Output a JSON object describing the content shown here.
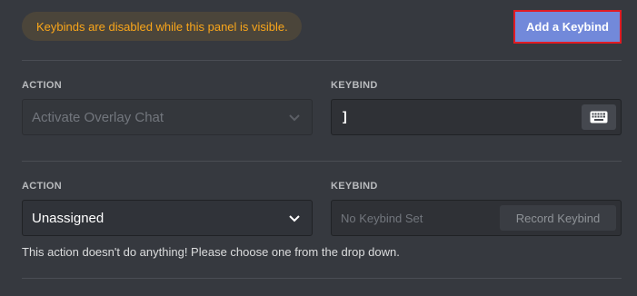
{
  "notice": "Keybinds are disabled while this panel is visible.",
  "add_button": "Add a Keybind",
  "keybinds": [
    {
      "action_label": "ACTION",
      "action_value": "Activate Overlay Chat",
      "keybind_label": "KEYBIND",
      "keybind_value": "]",
      "keyboard_icon": "keyboard-icon"
    },
    {
      "action_label": "ACTION",
      "action_value": "Unassigned",
      "keybind_label": "KEYBIND",
      "keybind_placeholder": "No Keybind Set",
      "record_button": "Record Keybind",
      "hint": "This action doesn't do anything! Please choose one from the drop down."
    }
  ],
  "colors": {
    "background": "#36393f",
    "accent": "#7289da",
    "warning_text": "#faa61a",
    "highlight_border": "#e01b24"
  }
}
